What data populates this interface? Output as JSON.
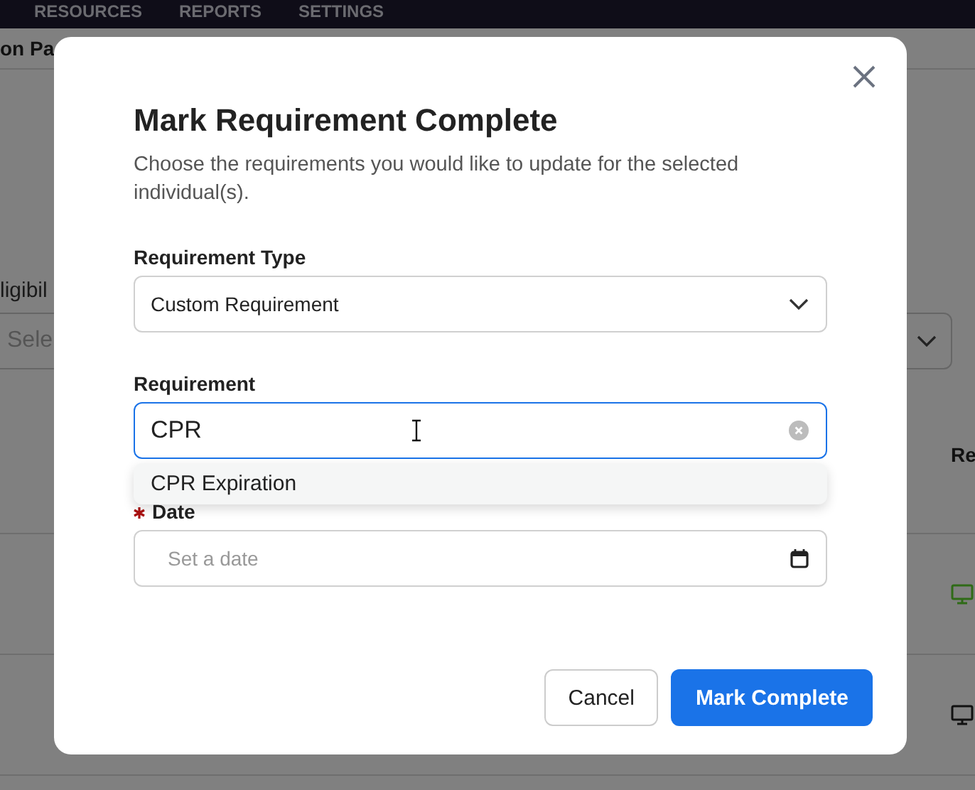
{
  "background": {
    "nav_items": [
      "RESOURCES",
      "REPORTS",
      "SETTINGS"
    ],
    "breadcrumb": "on Pa",
    "filter_label": "ligibil",
    "filter_select": {
      "placeholder": "Sele"
    },
    "column_header": "Re",
    "rows": [
      {
        "color": "#2f6b17"
      },
      {
        "color": "#111111"
      }
    ]
  },
  "dialog": {
    "title": "Mark Requirement Complete",
    "subtitle": "Choose the requirements you would like to update for the selected individual(s).",
    "fields": [
      {
        "kind": "select",
        "label": "Requirement Type",
        "required": false,
        "value": "Custom Requirement"
      },
      {
        "kind": "search",
        "label": "Requirement",
        "required": false,
        "value": "CPR",
        "focused": true,
        "suggestions": [
          "CPR Expiration"
        ]
      },
      {
        "kind": "date",
        "label": "Date",
        "required": true,
        "placeholder": "Set a date"
      }
    ],
    "buttons": [
      {
        "label": "Cancel",
        "kind": "secondary"
      },
      {
        "label": "Mark Complete",
        "kind": "primary"
      }
    ]
  }
}
